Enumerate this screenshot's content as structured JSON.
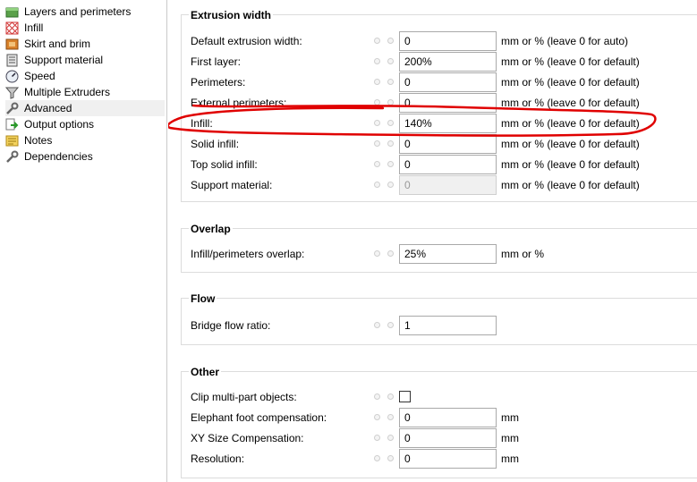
{
  "sidebar": {
    "items": [
      {
        "label": "Layers and perimeters",
        "icon": "layers-icon"
      },
      {
        "label": "Infill",
        "icon": "infill-icon"
      },
      {
        "label": "Skirt and brim",
        "icon": "skirt-brim-icon"
      },
      {
        "label": "Support material",
        "icon": "support-material-icon"
      },
      {
        "label": "Speed",
        "icon": "speed-icon"
      },
      {
        "label": "Multiple Extruders",
        "icon": "funnel-icon"
      },
      {
        "label": "Advanced",
        "icon": "wrench-icon"
      },
      {
        "label": "Output options",
        "icon": "output-icon"
      },
      {
        "label": "Notes",
        "icon": "notes-icon"
      },
      {
        "label": "Dependencies",
        "icon": "wrench-icon"
      }
    ],
    "active_index": 6
  },
  "extrusion_width": {
    "title": "Extrusion width",
    "rows": [
      {
        "label": "Default extrusion width:",
        "value": "0",
        "unit": "mm or % (leave 0 for auto)"
      },
      {
        "label": "First layer:",
        "value": "200%",
        "unit": "mm or % (leave 0 for default)"
      },
      {
        "label": "Perimeters:",
        "value": "0",
        "unit": "mm or % (leave 0 for default)"
      },
      {
        "label": "External perimeters:",
        "value": "0",
        "unit": "mm or % (leave 0 for default)"
      },
      {
        "label": "Infill:",
        "value": "140%",
        "unit": "mm or % (leave 0 for default)"
      },
      {
        "label": "Solid infill:",
        "value": "0",
        "unit": "mm or % (leave 0 for default)"
      },
      {
        "label": "Top solid infill:",
        "value": "0",
        "unit": "mm or % (leave 0 for default)"
      },
      {
        "label": "Support material:",
        "value": "0",
        "unit": "mm or % (leave 0 for default)",
        "disabled": true
      }
    ]
  },
  "overlap": {
    "title": "Overlap",
    "rows": [
      {
        "label": "Infill/perimeters overlap:",
        "value": "25%",
        "unit": "mm or %"
      }
    ]
  },
  "flow": {
    "title": "Flow",
    "rows": [
      {
        "label": "Bridge flow ratio:",
        "value": "1",
        "unit": ""
      }
    ]
  },
  "other": {
    "title": "Other",
    "clip_label": "Clip multi-part objects:",
    "clip_checked": false,
    "rows": [
      {
        "label": "Elephant foot compensation:",
        "value": "0",
        "unit": "mm"
      },
      {
        "label": "XY Size Compensation:",
        "value": "0",
        "unit": "mm"
      },
      {
        "label": "Resolution:",
        "value": "0",
        "unit": "mm"
      }
    ]
  },
  "colors": {
    "annotation": "#e00000",
    "active_item_bg": "#f0f0f0",
    "group_border": "#dcdcdc"
  }
}
